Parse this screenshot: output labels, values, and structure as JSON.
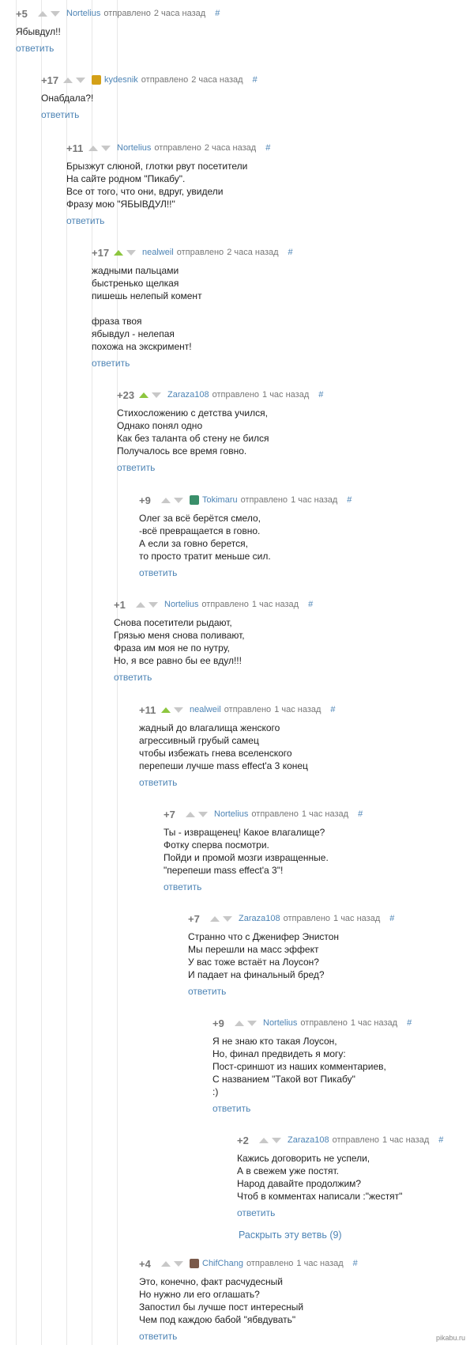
{
  "sent_label": "отправлено",
  "reply_label": "ответить",
  "comments": [
    {
      "rating": "+5",
      "author": "Nortelius",
      "time": "2 часа назад",
      "hash": "#",
      "text": "Ябывдул!!",
      "avatar": null,
      "up_active": false
    },
    {
      "rating": "+17",
      "author": "kydesnik",
      "time": "2 часа назад",
      "hash": "#",
      "text": "Онабдала?!",
      "avatar": "#d4a017",
      "up_active": false
    },
    {
      "rating": "+11",
      "author": "Nortelius",
      "time": "2 часа назад",
      "hash": "#",
      "text": "Брызжут слюной, глотки рвут посетители\nНа сайте родном \"Пикабу\".\nВсе от того, что они, вдруг, увидели\nФразу мою \"ЯБЫВДУЛ!!\"",
      "avatar": null,
      "up_active": false
    },
    {
      "rating": "+17",
      "author": "nealweil",
      "time": "2 часа назад",
      "hash": "#",
      "text": "жадными пальцами\nбыстренько щелкая\nпишешь нелепый комент\n\nфраза твоя\nябывдул - нелепая\nпохожа на экскримент!",
      "avatar": null,
      "up_active": true
    },
    {
      "rating": "+23",
      "author": "Zaraza108",
      "time": "1 час назад",
      "hash": "#",
      "text": "Стихосложению с детства учился,\nОднако понял одно\nКак без таланта об стену не бился\nПолучалось все время говно.",
      "avatar": null,
      "up_active": true
    },
    {
      "rating": "+9",
      "author": "Tokimaru",
      "time": "1 час назад",
      "hash": "#",
      "text": "Олег за всё берётся смело,\n-всё превращается в говно.\nА если за говно берется,\nто просто тратит меньше сил.",
      "avatar": "#3a8f6a",
      "up_active": false
    },
    {
      "rating": "+1",
      "author": "Nortelius",
      "time": "1 час назад",
      "hash": "#",
      "text": "Снова посетители рыдают,\nГрязью меня снова поливают,\nФраза им моя не по нутру,\nНо, я все равно бы ее вдул!!!",
      "avatar": null,
      "up_active": false
    },
    {
      "rating": "+11",
      "author": "nealweil",
      "time": "1 час назад",
      "hash": "#",
      "text": "жадный до влагалища женского\nагрессивный грубый самец\nчтобы избежать гнева вселенского\nперепеши лучше mass effect'а 3 конец",
      "avatar": null,
      "up_active": true
    },
    {
      "rating": "+7",
      "author": "Nortelius",
      "time": "1 час назад",
      "hash": "#",
      "text": "Ты - извращенец! Какое влагалище?\nФотку сперва посмотри.\nПойди и промой мозги извращенные.\n\"перепеши mass effect'а 3\"!",
      "avatar": null,
      "up_active": false
    },
    {
      "rating": "+7",
      "author": "Zaraza108",
      "time": "1 час назад",
      "hash": "#",
      "text": "Странно что с Дженифер Энистон\nМы перешли на масс эффект\nУ вас тоже встаёт на Лоусон?\nИ падает на финальный бред?",
      "avatar": null,
      "up_active": false
    },
    {
      "rating": "+9",
      "author": "Nortelius",
      "time": "1 час назад",
      "hash": "#",
      "text": "Я не знаю кто такая Лоусон,\nНо, финал предвидеть я могу:\nПост-сриншот из наших комментариев,\nС названием \"Такой вот Пикабу\"\n:)",
      "avatar": null,
      "up_active": false
    },
    {
      "rating": "+2",
      "author": "Zaraza108",
      "time": "1 час назад",
      "hash": "#",
      "text": "Кажись договорить не успели,\nА в свежем уже постят.\nНарод давайте продолжим?\nЧтоб в комментах написали :\"жестят\"",
      "avatar": null,
      "up_active": false
    },
    {
      "rating": "+4",
      "author": "ChifChang",
      "time": "1 час назад",
      "hash": "#",
      "text": "Это, конечно, факт расчудесный\nНо нужно ли его оглашать?\nЗапостил бы лучше пост интересный\nЧем под каждою бабой \"ябвдувать\"",
      "avatar": "#7a5a4a",
      "up_active": false
    }
  ],
  "expand_branch": "Раскрыть эту ветвь (9)",
  "watermark": "pikabu.ru"
}
